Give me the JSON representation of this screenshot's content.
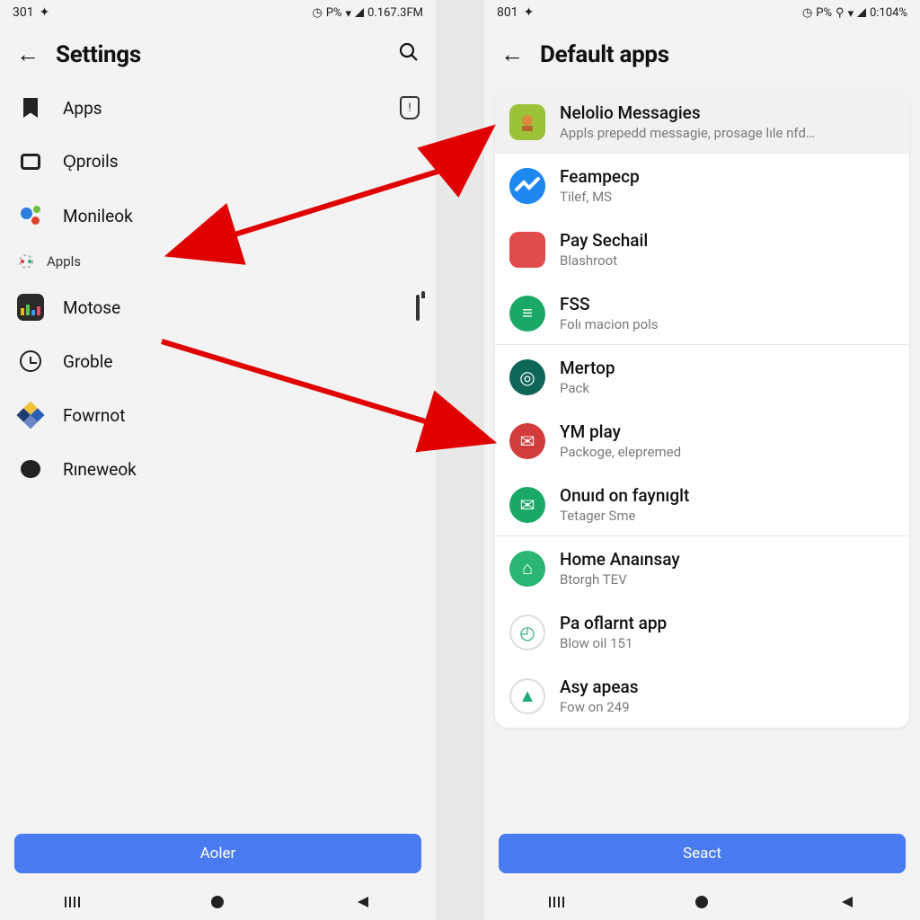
{
  "left": {
    "status": {
      "time": "301",
      "right_text": "0.167.3FM",
      "pk": "P%"
    },
    "title": "Settings",
    "items": [
      {
        "label": "Apps",
        "trail": "shield"
      },
      {
        "label": "Ǫproils"
      },
      {
        "label": "Monileok"
      },
      {
        "label": "Appls",
        "small": true
      },
      {
        "label": "Motose",
        "trail": "trash"
      },
      {
        "label": "Groble"
      },
      {
        "label": "Fowrnot"
      },
      {
        "label": "Rıneweok"
      }
    ],
    "button": "Aoler"
  },
  "right": {
    "status": {
      "time": "801",
      "right_text": "0:104%",
      "pk": "P%"
    },
    "title": "Default apps",
    "apps": [
      {
        "title": "Nelolio Messagies",
        "sub": "Appls prepedd messagie, prosage lıle nfd…",
        "icon_bg": "#9cc23a",
        "shape": "sq",
        "highlight": true
      },
      {
        "title": "Feampecp",
        "sub": "Tilef, MS",
        "icon_bg": "#1e88f0",
        "glyph": "~"
      },
      {
        "title": "Pay Sechail",
        "sub": "Blashroot",
        "icon_bg": "#e14b4b",
        "shape": "sq"
      },
      {
        "title": "FSS",
        "sub": "Folı macion pols",
        "icon_bg": "#1aa866",
        "glyph": "≡",
        "divider": true
      },
      {
        "title": "Mertop",
        "sub": "Pack",
        "icon_bg": "#0e6658",
        "glyph": "◎"
      },
      {
        "title": "YM play",
        "sub": "Packoge, elepremed",
        "icon_bg": "#d23c3c",
        "glyph": "✉"
      },
      {
        "title": "Onuıd on faynıglt",
        "sub": "Tetager Sme",
        "icon_bg": "#1aa866",
        "glyph": "✉",
        "divider": true
      },
      {
        "title": "Home Anaınsay",
        "sub": "Btorgh TEV",
        "icon_bg": "#2bb673",
        "glyph": "⌂"
      },
      {
        "title": "Pa oflarnt app",
        "sub": "Blow oil 151",
        "icon_bg": "#ffffff",
        "glyph": "◴",
        "ring": true
      },
      {
        "title": "Asy apeas",
        "sub": "Fow on 249",
        "icon_bg": "#ffffff",
        "glyph": "▲",
        "ring": true
      }
    ],
    "button": "Seact"
  }
}
